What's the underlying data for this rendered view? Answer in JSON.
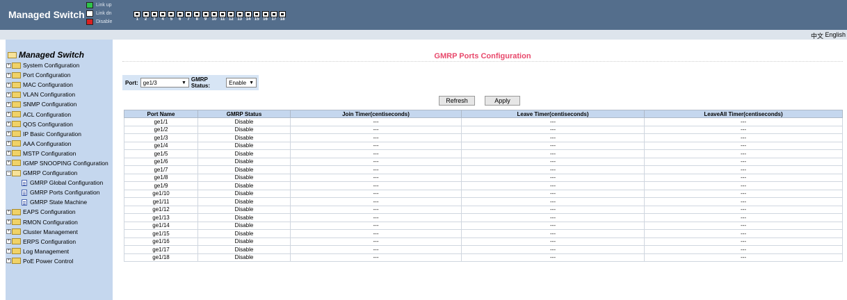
{
  "header": {
    "title": "Managed Switch",
    "legend": [
      {
        "label": "Link up",
        "color": "#2ec44a"
      },
      {
        "label": "Link dn",
        "color": "#ffffff"
      },
      {
        "label": "Disable",
        "color": "#d92020"
      }
    ],
    "ports": [
      "1",
      "2",
      "3",
      "4",
      "5",
      "6",
      "7",
      "8",
      "9",
      "10",
      "11",
      "12",
      "13",
      "14",
      "15",
      "16",
      "17",
      "18"
    ],
    "background": "#546e8c"
  },
  "lang": {
    "zh": "中文",
    "en": "English"
  },
  "sidebar": {
    "title": "Managed Switch",
    "items": [
      {
        "label": "System Configuration"
      },
      {
        "label": "Port Configuration"
      },
      {
        "label": "MAC Configuration"
      },
      {
        "label": "VLAN Configuration"
      },
      {
        "label": "SNMP Configuration"
      },
      {
        "label": "ACL Configuration"
      },
      {
        "label": "QOS Configuration"
      },
      {
        "label": "IP Basic Configuration"
      },
      {
        "label": "AAA Configuration"
      },
      {
        "label": "MSTP Configuration"
      },
      {
        "label": "IGMP SNOOPING Configuration"
      },
      {
        "label": "GMRP Configuration",
        "expanded": true,
        "children": [
          {
            "label": "GMRP Global Configuration"
          },
          {
            "label": "GMRP Ports Configuration"
          },
          {
            "label": "GMRP State Machine"
          }
        ]
      },
      {
        "label": "EAPS Configuration"
      },
      {
        "label": "RMON Configuration"
      },
      {
        "label": "Cluster Management"
      },
      {
        "label": "ERPS Configuration"
      },
      {
        "label": "Log Management"
      },
      {
        "label": "PoE Power Control"
      }
    ]
  },
  "main": {
    "title": "GMRP Ports Configuration",
    "title_color": "#e8486b",
    "port_label": "Port:",
    "port_value": "ge1/3",
    "gmrp_status_label": "GMRP Status:",
    "gmrp_status_value": "Enable",
    "refresh_label": "Refresh",
    "apply_label": "Apply",
    "table": {
      "headers": [
        "Port Name",
        "GMRP Status",
        "Join Timer(centiseconds)",
        "Leave Timer(centiseconds)",
        "LeaveAll Timer(centiseconds)"
      ],
      "rows": [
        [
          "ge1/1",
          "Disable",
          "---",
          "---",
          "---"
        ],
        [
          "ge1/2",
          "Disable",
          "---",
          "---",
          "---"
        ],
        [
          "ge1/3",
          "Disable",
          "---",
          "---",
          "---"
        ],
        [
          "ge1/4",
          "Disable",
          "---",
          "---",
          "---"
        ],
        [
          "ge1/5",
          "Disable",
          "---",
          "---",
          "---"
        ],
        [
          "ge1/6",
          "Disable",
          "---",
          "---",
          "---"
        ],
        [
          "ge1/7",
          "Disable",
          "---",
          "---",
          "---"
        ],
        [
          "ge1/8",
          "Disable",
          "---",
          "---",
          "---"
        ],
        [
          "ge1/9",
          "Disable",
          "---",
          "---",
          "---"
        ],
        [
          "ge1/10",
          "Disable",
          "---",
          "---",
          "---"
        ],
        [
          "ge1/11",
          "Disable",
          "---",
          "---",
          "---"
        ],
        [
          "ge1/12",
          "Disable",
          "---",
          "---",
          "---"
        ],
        [
          "ge1/13",
          "Disable",
          "---",
          "---",
          "---"
        ],
        [
          "ge1/14",
          "Disable",
          "---",
          "---",
          "---"
        ],
        [
          "ge1/15",
          "Disable",
          "---",
          "---",
          "---"
        ],
        [
          "ge1/16",
          "Disable",
          "---",
          "---",
          "---"
        ],
        [
          "ge1/17",
          "Disable",
          "---",
          "---",
          "---"
        ],
        [
          "ge1/18",
          "Disable",
          "---",
          "---",
          "---"
        ]
      ]
    }
  }
}
